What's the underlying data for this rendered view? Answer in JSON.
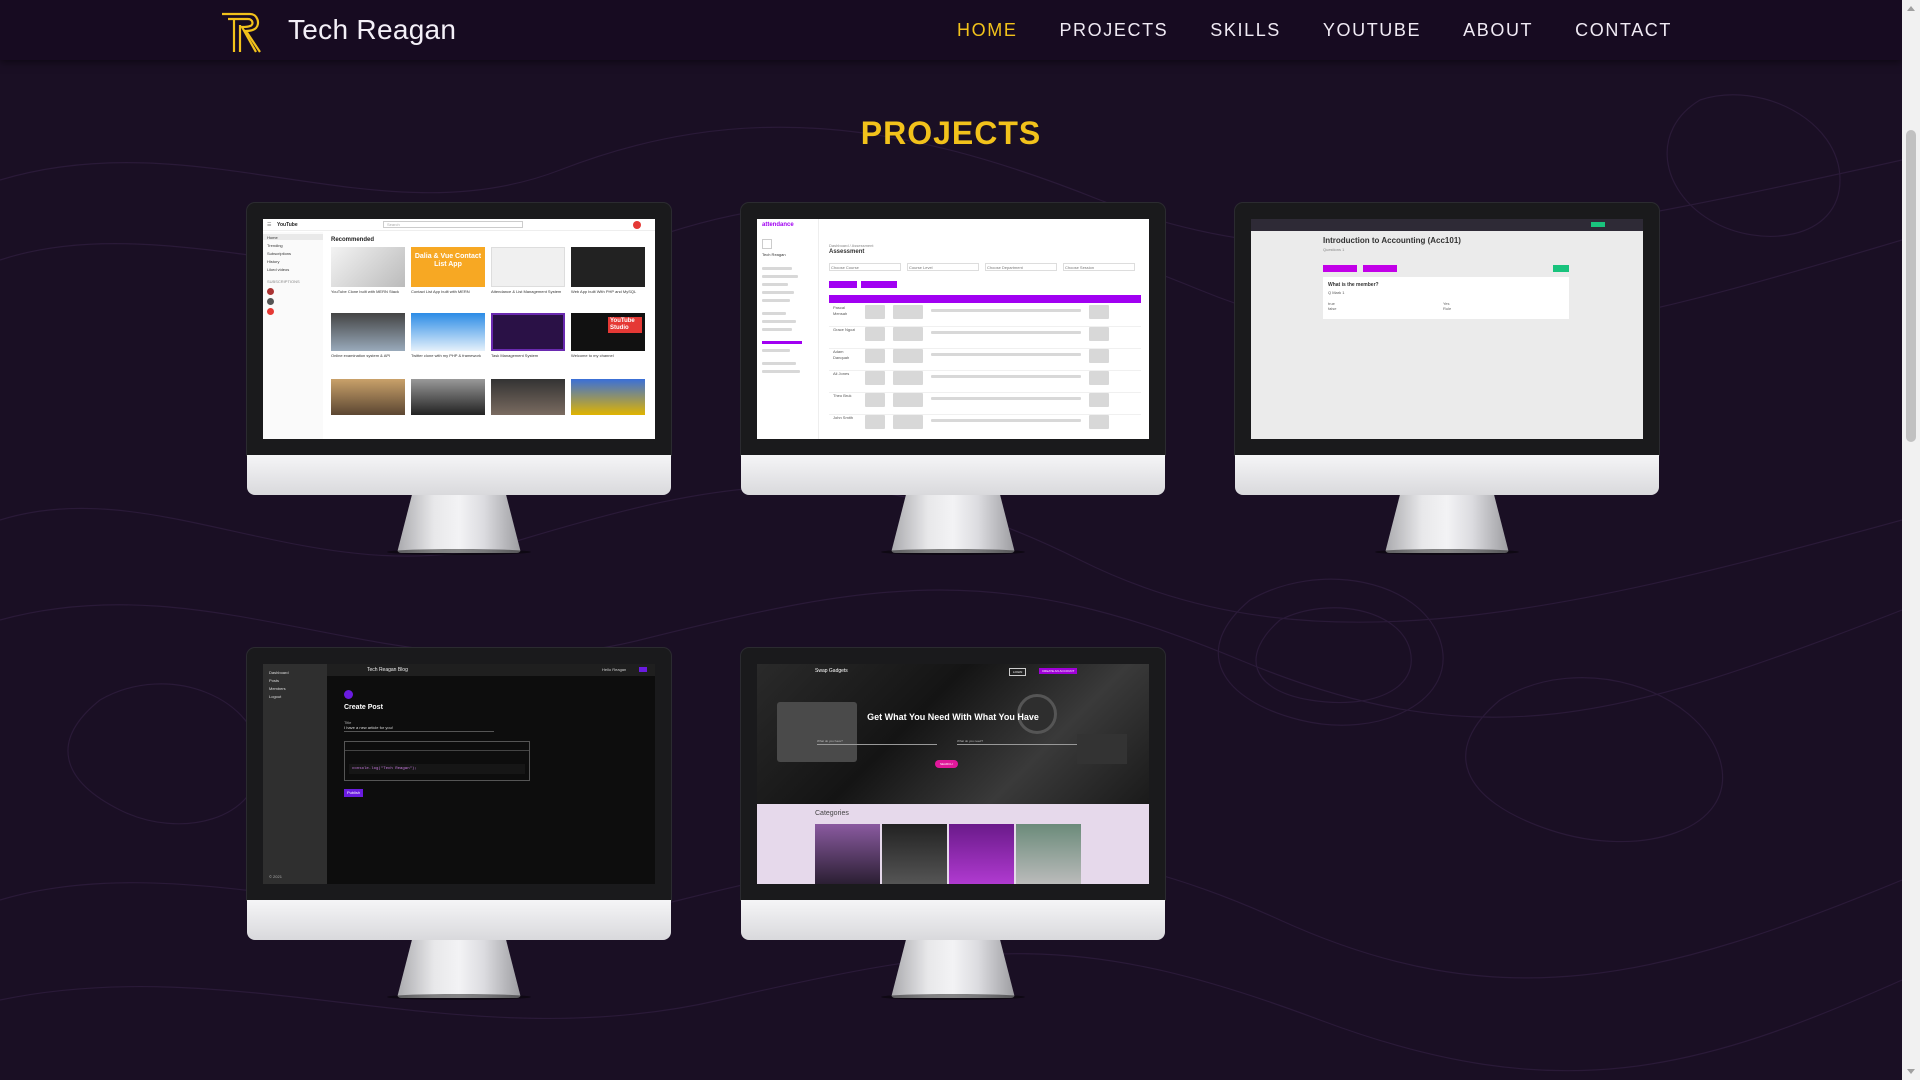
{
  "nav": {
    "brand": "Tech Reagan",
    "links": [
      {
        "label": "HOME",
        "active": true
      },
      {
        "label": "PROJECTS",
        "active": false
      },
      {
        "label": "SKILLS",
        "active": false
      },
      {
        "label": "YOUTUBE",
        "active": false
      },
      {
        "label": "ABOUT",
        "active": false
      },
      {
        "label": "CONTACT",
        "active": false
      }
    ]
  },
  "colors": {
    "accent": "#f2c21b",
    "background": "#1a0f24",
    "nav_background": "#170b21",
    "purple": "#a100f2"
  },
  "section": {
    "title": "PROJECTS"
  },
  "projects": {
    "youtube": {
      "app_name": "YouTube",
      "search_placeholder": "Search",
      "heading": "Recommended",
      "sidebar": [
        "Home",
        "Trending",
        "Subscriptions",
        "History",
        "Liked videos"
      ],
      "sidebar_section": "SUBSCRIPTIONS",
      "video_titles": [
        "YouTube Clone built with MERN Stack",
        "Contact List App built with MERN",
        "Attendance & List Management System",
        "Web App built With PHP and MySQL",
        "Online examination system & API",
        "Twitter clone with my PHP & framework",
        "Task Management System",
        "Welcome to my channel"
      ],
      "thumb_text": "Dalia & Vue Contact List App",
      "thumb_badge": "YouTube Studio"
    },
    "attendance": {
      "brand": "attendance",
      "page_title": "Assessment",
      "crumb": "Dashboard / Assessment",
      "user": "Tech Reagan",
      "filters": [
        "Choose Course",
        "Course Level",
        "Choose Department",
        "Choose Session"
      ],
      "rows": [
        "Pascal Mensah",
        "Grace Ngozi",
        "Adam Danquah",
        "Ali Jones",
        "Theo Bruk",
        "John Smith"
      ]
    },
    "quiz": {
      "title": "Introduction to Accounting (Acc101)",
      "subtitle": "Questions 1",
      "question": "What is the member?",
      "q_label": "Q Mark 1",
      "options": [
        "true",
        "false",
        "Yes",
        "Rule"
      ]
    },
    "blog": {
      "sidebar_title": "Dashboard",
      "sidebar_items": [
        "Posts",
        "Members",
        "Logout"
      ],
      "app_title": "Tech Reagan Blog",
      "user": "Hello Reagan",
      "heading": "Create Post",
      "field_label": "Title",
      "field_value": "I have a new article for you!",
      "code": "console.log(\"Tech Reagan\");",
      "button": "Publish",
      "footer": "© 2021"
    },
    "swap": {
      "brand": "Swap Gadgets",
      "login": "LOGIN",
      "cta": "CREATE AN ACCOUNT",
      "headline": "Get What You Need With What You Have",
      "field_left": "What do you have?",
      "field_right": "What do you need?",
      "search": "SEARCH",
      "categories": "Categories"
    }
  }
}
